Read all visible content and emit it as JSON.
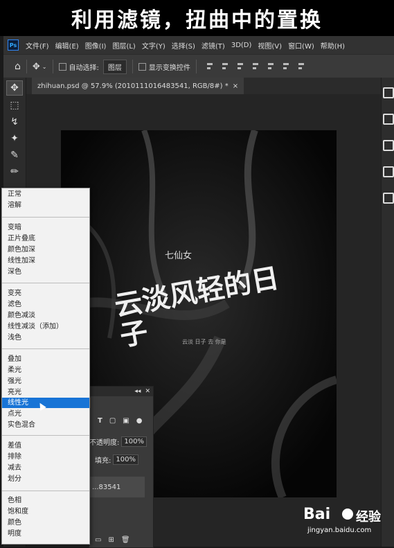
{
  "caption": "利用滤镜，扭曲中的置换",
  "app": {
    "logo": "Ps",
    "menus": [
      "文件(F)",
      "编辑(E)",
      "图像(I)",
      "图层(L)",
      "文字(Y)",
      "选择(S)",
      "滤镜(T)",
      "3D(D)",
      "视图(V)",
      "窗口(W)",
      "帮助(H)"
    ]
  },
  "options": {
    "auto_select_label": "自动选择:",
    "auto_select_value": "图层",
    "show_transform_label": "显示变换控件"
  },
  "document": {
    "tab_title": "zhihuan.psd @ 57.9% (2010111016483541, RGB/8#) *"
  },
  "artwork": {
    "small_title": "七仙女",
    "main_text": "云淡风轻的日子",
    "small_text": "云淡 日子 去 你是"
  },
  "layers_panel": {
    "opacity_label": "不透明度:",
    "opacity_value": "100%",
    "fill_label": "填充:",
    "fill_value": "100%",
    "layer_name": "...83541"
  },
  "blend_menu": {
    "groups": [
      [
        "正常",
        "溶解"
      ],
      [
        "变暗",
        "正片叠底",
        "颜色加深",
        "线性加深",
        "深色"
      ],
      [
        "变亮",
        "滤色",
        "颜色减淡",
        "线性减淡（添加）",
        "浅色"
      ],
      [
        "叠加",
        "柔光",
        "强光",
        "亮光",
        "线性光",
        "点光",
        "实色混合"
      ],
      [
        "差值",
        "排除",
        "减去",
        "划分"
      ],
      [
        "色相",
        "饱和度",
        "颜色",
        "明度"
      ]
    ],
    "selected": "线性光"
  },
  "watermark": {
    "brand": "Bai",
    "brand_suffix": "经验",
    "url": "jingyan.baidu.com"
  }
}
